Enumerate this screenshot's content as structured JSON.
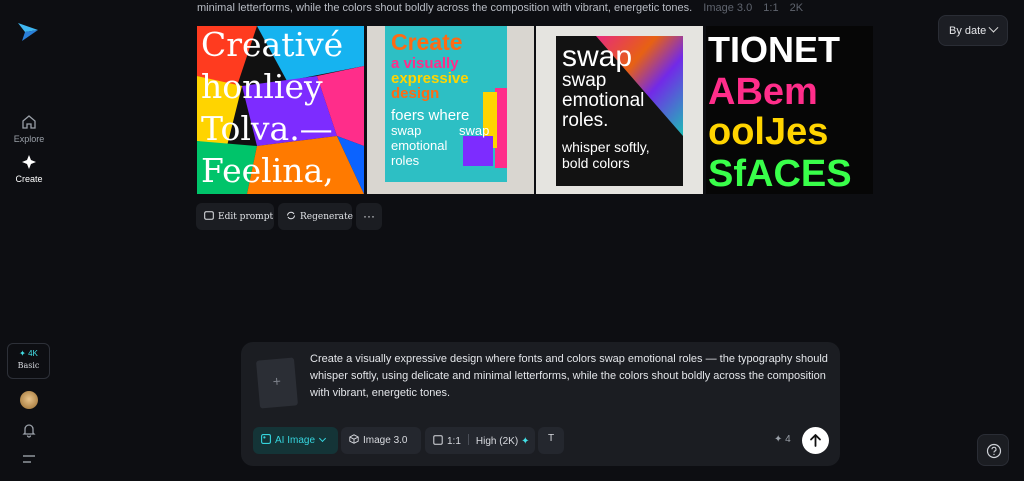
{
  "caption": {
    "text": "minimal letterforms, while the colors shout boldly across the composition with vibrant, energetic tones.",
    "model": "Image 3.0",
    "ratio": "1:1",
    "res": "2K"
  },
  "sidebar": {
    "explore": "Explore",
    "create": "Create",
    "plan_resolution": "✦ 4K",
    "plan_tier": "Basic"
  },
  "sort": {
    "label": "By date"
  },
  "images": [
    {
      "lines": [
        "Creativé",
        "honliey",
        "Tolva.—",
        "Feelina,"
      ]
    },
    {
      "lines": [
        "Create",
        "a visually",
        "expressive",
        "design",
        "foers where",
        "swap",
        "swap",
        "emotional",
        "roles"
      ]
    },
    {
      "lines": [
        "swap",
        "swap",
        "emotional",
        "roles.",
        "whisper softly,",
        "bold colors"
      ]
    },
    {
      "lines": [
        "TIONET",
        "ABem",
        "oolJes",
        "SfACES"
      ]
    }
  ],
  "actions": {
    "edit": "Edit prompt",
    "regenerate": "Regenerate",
    "more": "···"
  },
  "prompt": {
    "add": "+",
    "text": "Create a visually expressive design where fonts and colors swap emotional roles — the typography should whisper softly, using delicate and minimal letterforms, while the colors shout boldly across the composition with vibrant, energetic tones."
  },
  "toolbar": {
    "mode": "AI Image",
    "model": "Image 3.0",
    "ratio": "1:1",
    "quality": "High (2K)",
    "credits": "✦ 4",
    "text_tool": "T"
  },
  "colors": {
    "accent": "#35d4dd",
    "bg": "#0d0e12",
    "panel": "#1b1d22"
  }
}
